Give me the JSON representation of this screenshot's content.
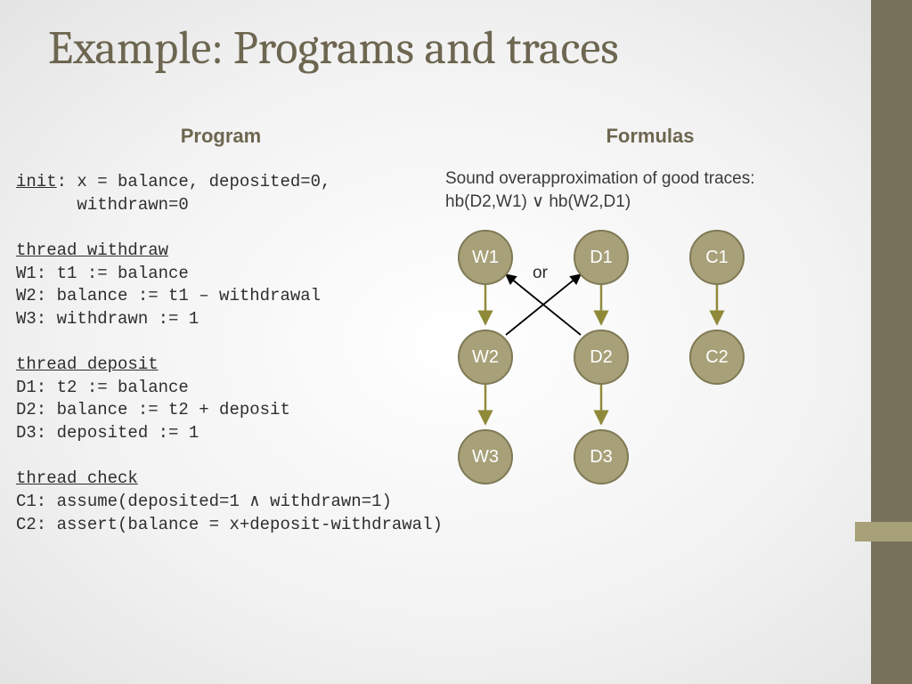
{
  "title": "Example: Programs and traces",
  "left": {
    "heading": "Program",
    "init_label": "init",
    "init_rest": ": x = balance, deposited=0,",
    "init_line2": "      withdrawn=0",
    "withdraw_label": "thread_withdraw",
    "w1": "W1: t1 := balance",
    "w2": "W2: balance := t1 – withdrawal",
    "w3": "W3: withdrawn := 1",
    "deposit_label": "thread_deposit",
    "d1": "D1: t2 := balance",
    "d2": "D2: balance := t2 + deposit",
    "d3": "D3: deposited := 1",
    "check_label": "thread_check",
    "c1": "C1: assume(deposited=1 ∧ withdrawn=1)",
    "c2": "C2: assert(balance = x+deposit-withdrawal)"
  },
  "right": {
    "heading": "Formulas",
    "line1": "Sound overapproximation of good traces:",
    "line2": "hb(D2,W1) ∨ hb(W2,D1)"
  },
  "diagram": {
    "or_label": "or",
    "nodes": {
      "W1": "W1",
      "W2": "W2",
      "W3": "W3",
      "D1": "D1",
      "D2": "D2",
      "D3": "D3",
      "C1": "C1",
      "C2": "C2"
    }
  }
}
